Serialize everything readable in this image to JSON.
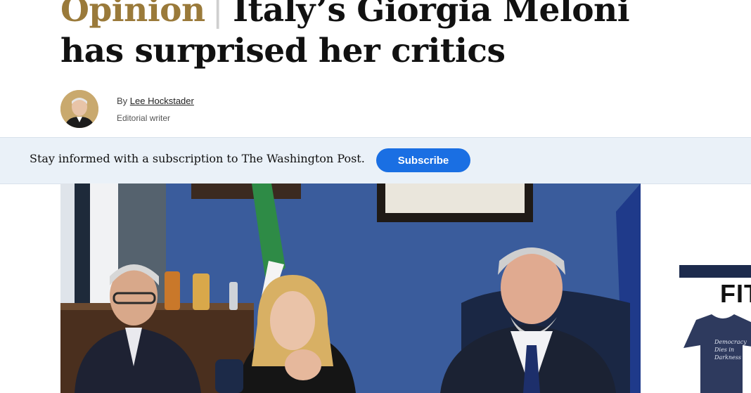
{
  "article": {
    "kicker": "Opinion",
    "separator": "|",
    "headline": "Italy’s Giorgia Meloni has surprised her critics",
    "byline_prefix": "By",
    "author": "Lee Hockstader",
    "author_role": "Editorial writer"
  },
  "banner": {
    "text": "Stay informed with a subscription to The Washington Post.",
    "button_label": "Subscribe"
  },
  "ad": {
    "headline_fragment": "FIT",
    "shirt_text": "Democracy Dies in Darkness"
  },
  "colors": {
    "kicker": "#9a7a3a",
    "subscribe_button": "#1a6fe3",
    "banner_bg": "#eaf1f8"
  }
}
